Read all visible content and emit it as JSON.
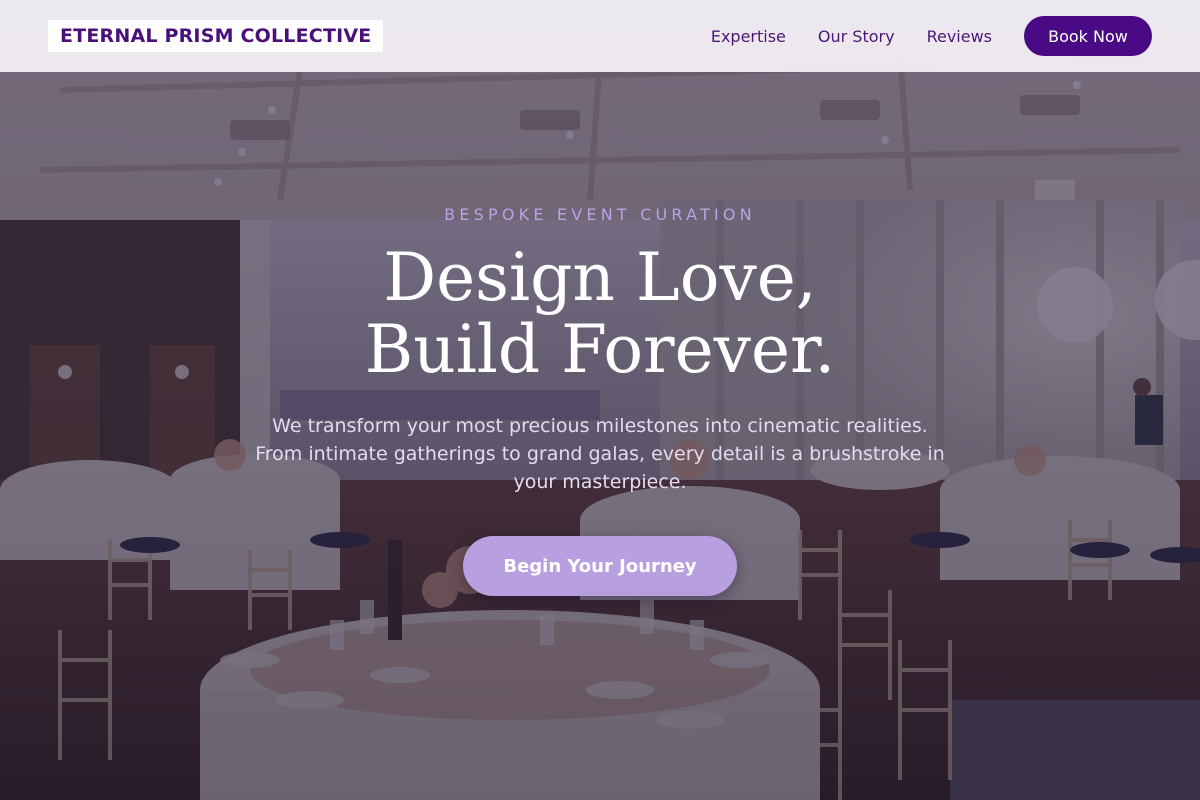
{
  "brand": {
    "name": "ETERNAL PRISM COLLECTIVE"
  },
  "nav": {
    "links": [
      {
        "label": "Expertise"
      },
      {
        "label": "Our Story"
      },
      {
        "label": "Reviews"
      }
    ],
    "cta_label": "Book Now"
  },
  "hero": {
    "eyebrow": "BESPOKE EVENT CURATION",
    "title_line1": "Design Love,",
    "title_line2": "Build Forever.",
    "subtitle": "We transform your most precious milestones into cinematic realities. From intimate gatherings to grand galas, every detail is a brushstroke in your masterpiece.",
    "cta_label": "Begin Your Journey"
  },
  "colors": {
    "brand_purple": "#4a0a85",
    "accent_lavender": "#b79fe0",
    "eyebrow_lavender": "#bba2e6",
    "nav_background": "#f5f2f8"
  }
}
